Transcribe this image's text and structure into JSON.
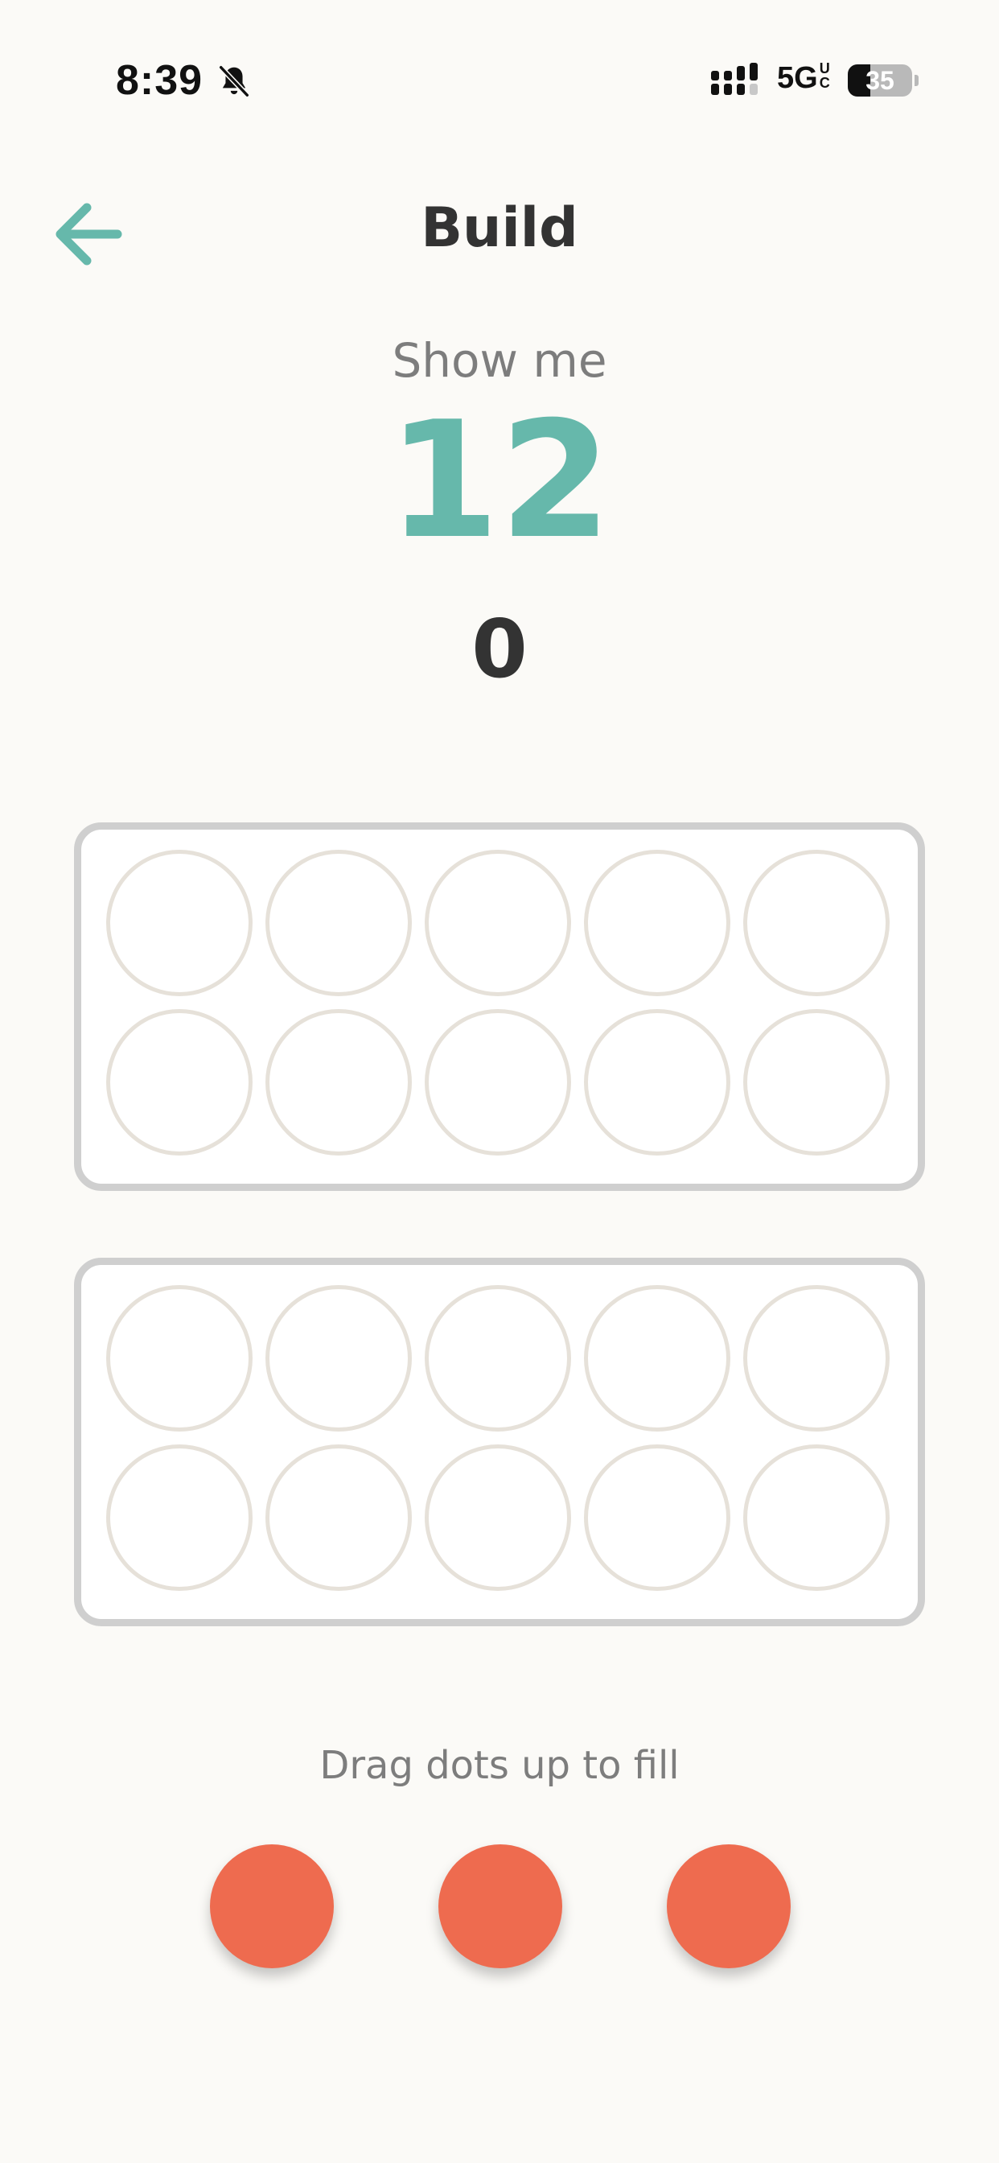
{
  "status_bar": {
    "time": "8:39",
    "network_main": "5G",
    "network_super_top": "U",
    "network_super_bottom": "C",
    "battery_percent": "35",
    "battery_level": 0.35,
    "icons": [
      "bell-slash-icon",
      "signal-bars-icon",
      "battery-icon"
    ]
  },
  "header": {
    "title": "Build",
    "back_icon": "arrow-left-icon"
  },
  "prompt": {
    "label": "Show me",
    "target": "12",
    "current_count": "0"
  },
  "ten_frames": [
    {
      "filled": 0,
      "slots": 10
    },
    {
      "filled": 0,
      "slots": 10
    }
  ],
  "instruction": "Drag dots up to fill",
  "draggable_dots": 3,
  "colors": {
    "accent": "#66b8ab",
    "dot": "#ee6b4f",
    "frame_border": "#cfcfcf",
    "slot_border": "#e6e1d9",
    "background": "#fbfaf7",
    "title_text": "#333333",
    "muted_text": "#7d7d7d"
  }
}
